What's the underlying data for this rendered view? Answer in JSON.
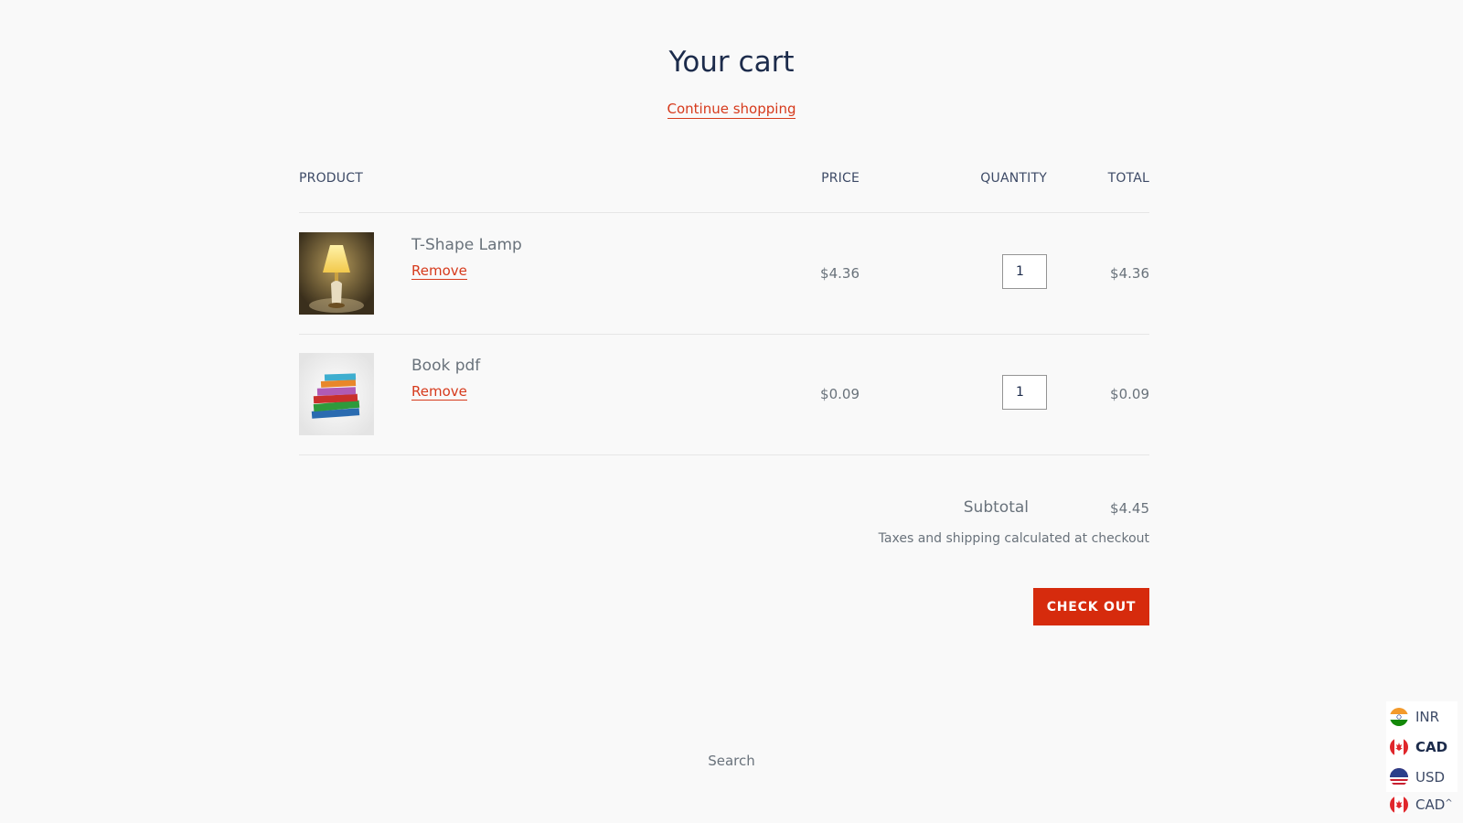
{
  "page": {
    "title": "Your cart",
    "continue_shopping": "Continue shopping"
  },
  "table": {
    "headers": {
      "product": "PRODUCT",
      "price": "PRICE",
      "quantity": "QUANTITY",
      "total": "TOTAL"
    },
    "items": [
      {
        "name": "T-Shape Lamp",
        "image": "lamp-image",
        "remove_label": "Remove",
        "price": "$4.36",
        "quantity": "1",
        "total": "$4.36"
      },
      {
        "name": "Book pdf",
        "image": "books-image",
        "remove_label": "Remove",
        "price": "$0.09",
        "quantity": "1",
        "total": "$0.09"
      }
    ]
  },
  "summary": {
    "subtotal_label": "Subtotal",
    "subtotal_value": "$4.45",
    "tax_note": "Taxes and shipping calculated at checkout",
    "checkout_label": "CHECK OUT"
  },
  "footer": {
    "search_link": "Search"
  },
  "currency_selector": {
    "options": [
      {
        "code": "INR",
        "flag": "india-flag-icon"
      },
      {
        "code": "CAD",
        "flag": "canada-flag-icon",
        "highlighted": true
      },
      {
        "code": "USD",
        "flag": "usa-flag-icon"
      }
    ],
    "selected": "CAD",
    "caret": "^"
  },
  "colors": {
    "accent": "#d63a1c",
    "checkout_bg": "#d62b0d",
    "heading": "#1c2b4b",
    "text": "#69727b",
    "background": "#f9f9f9"
  }
}
